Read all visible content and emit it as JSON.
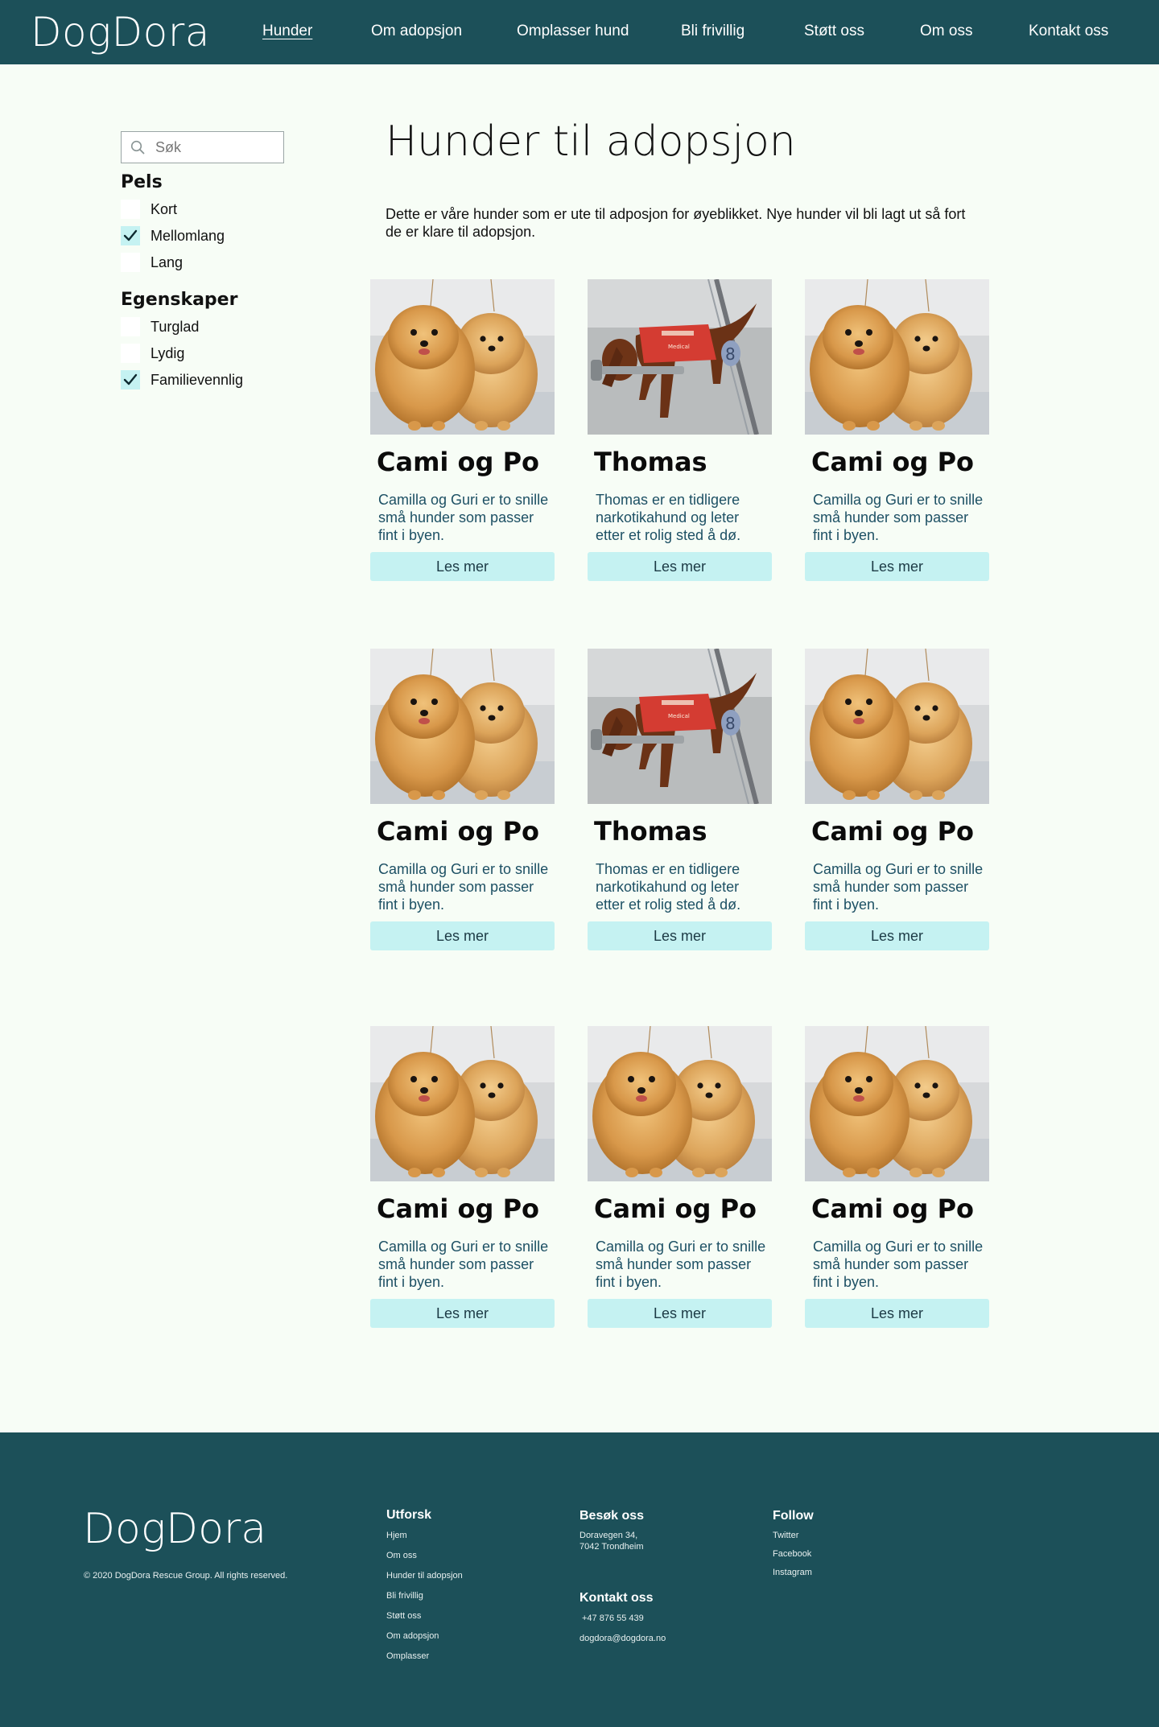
{
  "header": {
    "logo": "DogDora",
    "nav": [
      {
        "label": "Hunder",
        "active": true
      },
      {
        "label": "Om adopsjon"
      },
      {
        "label": "Omplasser hund"
      },
      {
        "label": "Bli frivillig"
      },
      {
        "label": "Støtt oss"
      },
      {
        "label": "Om oss"
      },
      {
        "label": "Kontakt oss"
      }
    ]
  },
  "sidebar": {
    "search": {
      "placeholder": "Søk",
      "value": ""
    },
    "groups": [
      {
        "title": "Pels",
        "options": [
          {
            "label": "Kort",
            "checked": false
          },
          {
            "label": "Mellomlang",
            "checked": true
          },
          {
            "label": "Lang",
            "checked": false
          }
        ]
      },
      {
        "title": "Egenskaper",
        "options": [
          {
            "label": "Turglad",
            "checked": false
          },
          {
            "label": "Lydig",
            "checked": false
          },
          {
            "label": "Familievennlig",
            "checked": true
          }
        ]
      }
    ]
  },
  "main": {
    "title": "Hunder til adopsjon",
    "intro": "Dette er våre hunder som er ute til adposjon for øyeblikket. Nye hunder vil bli lagt ut så fort de er klare til adopsjon.",
    "cards": [
      {
        "name": "Cami og Po",
        "desc": "Camilla og Guri er to snille små hunder som passer fint i byen.",
        "button": "Les mer",
        "image": "pomeranians"
      },
      {
        "name": "Thomas",
        "desc": "Thomas er en tidligere narkotikahund og leter etter et rolig sted å dø.",
        "button": "Les mer",
        "image": "labrador"
      },
      {
        "name": "Cami og Po",
        "desc": "Camilla og Guri er to snille små hunder som passer fint i byen.",
        "button": "Les mer",
        "image": "pomeranians"
      },
      {
        "name": "Cami og Po",
        "desc": "Camilla og Guri er to snille små hunder som passer fint i byen.",
        "button": "Les mer",
        "image": "pomeranians"
      },
      {
        "name": "Thomas",
        "desc": "Thomas er en tidligere narkotikahund og leter etter et rolig sted å dø.",
        "button": "Les mer",
        "image": "labrador"
      },
      {
        "name": "Cami og Po",
        "desc": "Camilla og Guri er to snille små hunder som passer fint i byen.",
        "button": "Les mer",
        "image": "pomeranians"
      },
      {
        "name": "Cami og Po",
        "desc": "Camilla og Guri er to snille små hunder som passer fint i byen.",
        "button": "Les mer",
        "image": "pomeranians"
      },
      {
        "name": "Cami og Po",
        "desc": "Camilla og Guri er to snille små hunder som passer fint i byen.",
        "button": "Les mer",
        "image": "pomeranians"
      },
      {
        "name": "Cami og Po",
        "desc": "Camilla og Guri er to snille små hunder som passer fint i byen.",
        "button": "Les mer",
        "image": "pomeranians"
      }
    ]
  },
  "footer": {
    "logo": "DogDora",
    "copyright": "© 2020 DogDora Rescue Group. All rights reserved.",
    "explore": {
      "title": "Utforsk",
      "links": [
        "Hjem",
        "Om oss",
        "Hunder til adopsjon",
        "Bli frivillig",
        "Støtt oss",
        "Om adopsjon",
        "Omplasser"
      ]
    },
    "visit": {
      "title": "Besøk oss",
      "line1": "Doravegen 34,",
      "line2": "7042 Trondheim"
    },
    "contact": {
      "title": "Kontakt oss",
      "phone": "+47 876 55 439",
      "email": "dogdora@dogdora.no"
    },
    "follow": {
      "title": "Follow",
      "links": [
        "Twitter",
        "Facebook",
        "Instagram"
      ]
    }
  },
  "colors": {
    "primary": "#1c5059",
    "accent": "#c5f2f2",
    "background": "#f7fdf6",
    "text_blue": "#1d5064"
  }
}
